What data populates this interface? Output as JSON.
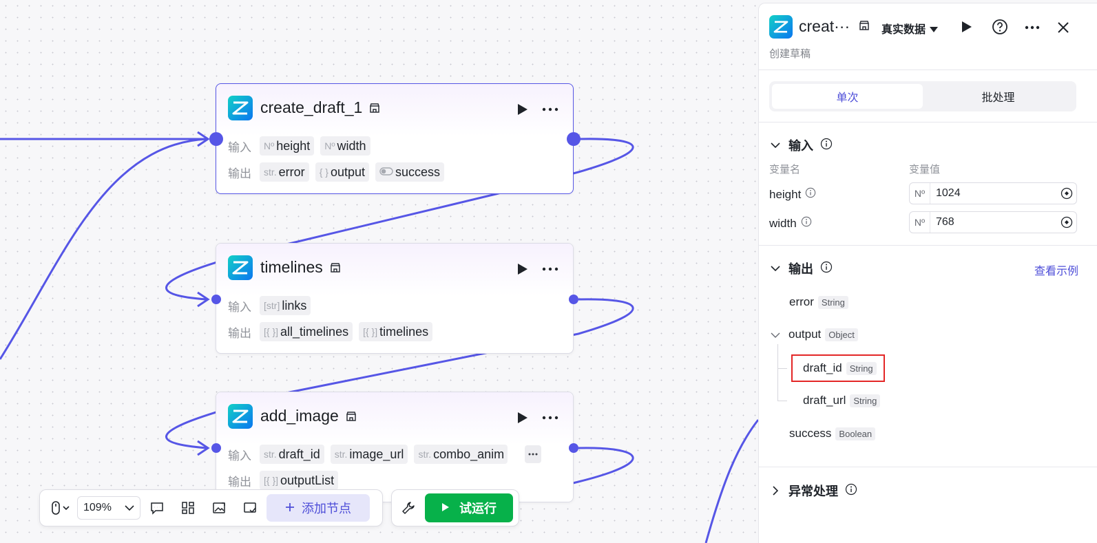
{
  "canvas": {
    "nodes": [
      {
        "title": "create_draft_1",
        "input_label": "输入",
        "output_label": "输出",
        "inputs": [
          {
            "type": "Nº",
            "name": "height"
          },
          {
            "type": "Nº",
            "name": "width"
          }
        ],
        "outputs": [
          {
            "type": "str.",
            "name": "error"
          },
          {
            "type": "{ }",
            "name": "output"
          },
          {
            "type": "toggle",
            "name": "success"
          }
        ]
      },
      {
        "title": "timelines",
        "input_label": "输入",
        "output_label": "输出",
        "inputs": [
          {
            "type": "[str]",
            "name": "links"
          }
        ],
        "outputs": [
          {
            "type": "[{ }]",
            "name": "all_timelines"
          },
          {
            "type": "[{ }]",
            "name": "timelines"
          }
        ]
      },
      {
        "title": "add_image",
        "input_label": "输入",
        "output_label": "输出",
        "inputs": [
          {
            "type": "str.",
            "name": "draft_id"
          },
          {
            "type": "str.",
            "name": "image_url"
          },
          {
            "type": "str.",
            "name": "combo_anim"
          }
        ],
        "outputs": [
          {
            "type": "[{ }]",
            "name": "outputList"
          }
        ]
      }
    ]
  },
  "toolbar": {
    "zoom": "109%",
    "add_node": "添加节点",
    "test_run": "试运行"
  },
  "panel": {
    "title": "creat···",
    "data_mode": "真实数据",
    "subtitle": "创建草稿",
    "tabs": [
      "单次",
      "批处理"
    ],
    "input_section": "输入",
    "col_name": "变量名",
    "col_value": "变量值",
    "inputs": [
      {
        "name": "height",
        "type": "Nº",
        "value": "1024"
      },
      {
        "name": "width",
        "type": "Nº",
        "value": "768"
      }
    ],
    "output_section": "输出",
    "view_example": "查看示例",
    "outputs": {
      "error": {
        "name": "error",
        "type": "String"
      },
      "output": {
        "name": "output",
        "type": "Object"
      },
      "draft_id": {
        "name": "draft_id",
        "type": "String"
      },
      "draft_url": {
        "name": "draft_url",
        "type": "String"
      },
      "success": {
        "name": "success",
        "type": "Boolean"
      }
    },
    "exception_section": "异常处理"
  },
  "colors": {
    "accent": "#5656e6",
    "run_green": "#07b14a",
    "highlight_red": "#e32626"
  }
}
